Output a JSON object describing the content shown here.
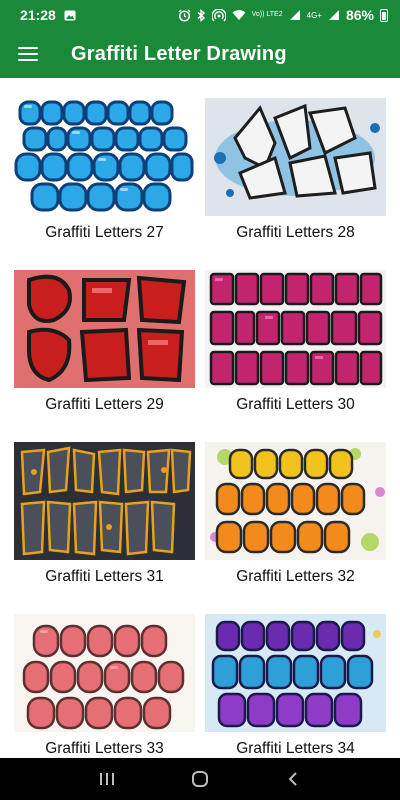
{
  "status_bar": {
    "time": "21:28",
    "signal_top": "Vo)) LTE2",
    "signal_right": "4G+",
    "battery": "86%"
  },
  "app_bar": {
    "title": "Graffiti Letter Drawing",
    "menu_icon": "hamburger-menu-icon"
  },
  "items": [
    {
      "title": "Graffiti Letters 27",
      "colors": [
        "#2aa8e8",
        "#0d3f7a"
      ]
    },
    {
      "title": "Graffiti Letters 28",
      "colors": [
        "#dfe3ea",
        "#3a3a3a"
      ]
    },
    {
      "title": "Graffiti Letters 29",
      "colors": [
        "#e07070",
        "#c81e1e"
      ]
    },
    {
      "title": "Graffiti Letters 30",
      "colors": [
        "#f2f2f2",
        "#c2246e"
      ]
    },
    {
      "title": "Graffiti Letters 31",
      "colors": [
        "#2c2f36",
        "#e6a11e"
      ]
    },
    {
      "title": "Graffiti Letters 32",
      "colors": [
        "#f6f3ee",
        "#f28a1c"
      ]
    },
    {
      "title": "Graffiti Letters 33",
      "colors": [
        "#f8f4ef",
        "#e56f74"
      ]
    },
    {
      "title": "Graffiti Letters 34",
      "colors": [
        "#d6e9f5",
        "#6b2bb0"
      ]
    }
  ],
  "nav_bar": {
    "recents_icon": "recents-icon",
    "home_icon": "home-icon",
    "back_icon": "back-icon"
  }
}
